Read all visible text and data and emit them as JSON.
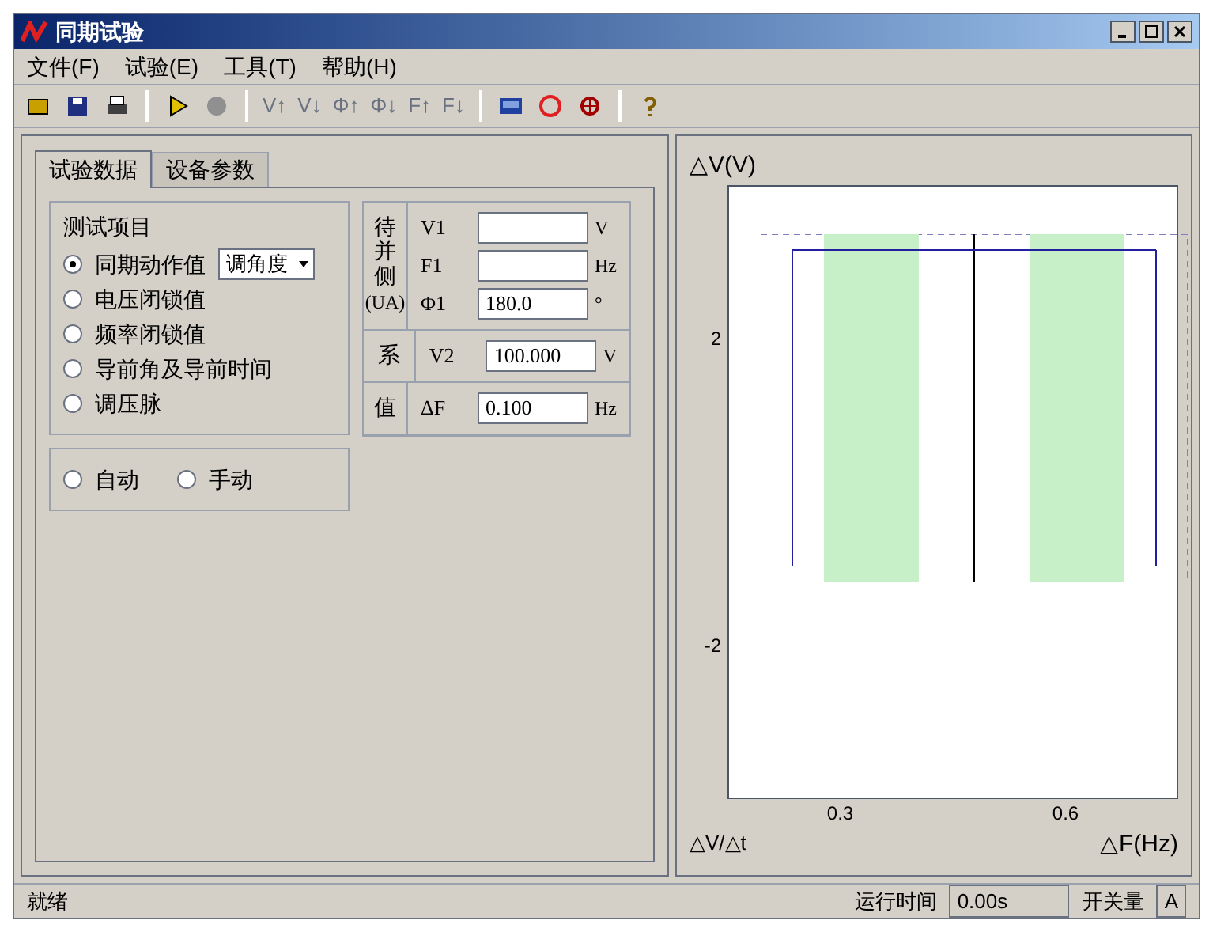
{
  "window": {
    "title": "同期试验"
  },
  "menu": [
    "文件(F)",
    "试验(E)",
    "工具(T)",
    "帮助(H)"
  ],
  "toolbar": [
    {
      "kind": "icon"
    },
    {
      "kind": "icon"
    },
    {
      "kind": "icon"
    },
    {
      "kind": "sep"
    },
    {
      "kind": "icon"
    },
    {
      "kind": "icon"
    },
    {
      "kind": "sep"
    },
    {
      "kind": "text",
      "label": "V↑"
    },
    {
      "kind": "text",
      "label": "V↓"
    },
    {
      "kind": "text",
      "label": "Φ↑"
    },
    {
      "kind": "text",
      "label": "Φ↓"
    },
    {
      "kind": "text",
      "label": "F↑"
    },
    {
      "kind": "text",
      "label": "F↓"
    },
    {
      "kind": "sep"
    },
    {
      "kind": "icon"
    },
    {
      "kind": "icon"
    },
    {
      "kind": "icon"
    },
    {
      "kind": "sep"
    },
    {
      "kind": "icon"
    }
  ],
  "tabs": [
    {
      "label": "试验数据",
      "selected": true
    },
    {
      "label": "设备参数",
      "selected": false
    }
  ],
  "test_items": {
    "title": "测试项目",
    "options": [
      {
        "label": "同期动作值",
        "selected": true
      },
      {
        "label": "电压闭锁值",
        "selected": false
      },
      {
        "label": "频率闭锁值",
        "selected": false
      },
      {
        "label": "导前角及导前时间",
        "selected": false
      },
      {
        "label": "调压脉",
        "selected": false
      }
    ],
    "dropdown": "调角度"
  },
  "mode": [
    {
      "label": "自动",
      "selected": false
    },
    {
      "label": "手动",
      "selected": false
    }
  ],
  "side_a": {
    "label": "待并侧",
    "sub": "(UA)",
    "fields": [
      {
        "name": "V1",
        "unit": "V"
      },
      {
        "name": "F1",
        "unit": "Hz"
      },
      {
        "name": "Φ1",
        "value": "180.0",
        "unit": "°"
      }
    ]
  },
  "side_b": {
    "label": "系",
    "fields": [
      {
        "name": "V2",
        "value": "100.000",
        "unit": "V"
      }
    ]
  },
  "step": {
    "label": "值",
    "fields": [
      {
        "name": "ΔF",
        "value": "0.100",
        "unit": "Hz"
      }
    ]
  },
  "chart": {
    "ylabel": "△V(V)",
    "yticks": [
      "2",
      "-2"
    ],
    "xlabel": "△F(Hz)",
    "xticks": [
      "0.3",
      "0.6"
    ],
    "legend": "△V/△t"
  },
  "status_bar": {
    "message": "就绪",
    "time_label": "运行时间",
    "time_value": "0.00s",
    "io_label": "开关量",
    "io_value": "A"
  }
}
